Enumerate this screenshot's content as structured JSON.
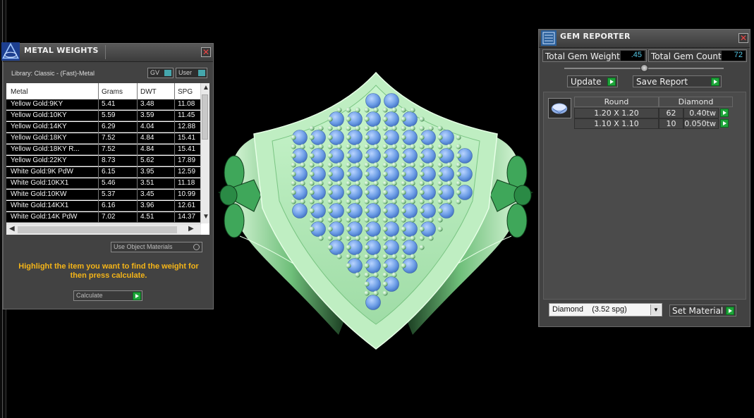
{
  "metal_weights": {
    "title": "METAL WEIGHTS",
    "library_label": "Library: Classic - (Fast)-Metal",
    "toggle_gv": "GV",
    "toggle_user": "User",
    "columns": [
      "Metal",
      "Grams",
      "DWT",
      "SPG"
    ],
    "rows": [
      [
        "Yellow Gold:9KY",
        "5.41",
        "3.48",
        "11.08"
      ],
      [
        "Yellow Gold:10KY",
        "5.59",
        "3.59",
        "11.45"
      ],
      [
        "Yellow Gold:14KY",
        "6.29",
        "4.04",
        "12.88"
      ],
      [
        "Yellow Gold:18KY",
        "7.52",
        "4.84",
        "15.41"
      ],
      [
        "Yellow Gold:18KY R...",
        "7.52",
        "4.84",
        "15.41"
      ],
      [
        "Yellow Gold:22KY",
        "8.73",
        "5.62",
        "17.89"
      ],
      [
        "White Gold:9K PdW",
        "6.15",
        "3.95",
        "12.59"
      ],
      [
        "White Gold:10KX1",
        "5.46",
        "3.51",
        "11.18"
      ],
      [
        "White Gold:10KW",
        "5.37",
        "3.45",
        "10.99"
      ],
      [
        "White Gold:14KX1",
        "6.16",
        "3.96",
        "12.61"
      ],
      [
        "White Gold:14K PdW",
        "7.02",
        "4.51",
        "14.37"
      ]
    ],
    "use_object_materials": "Use Object Materials",
    "hint": "Highlight the item you want to find the weight for then press calculate.",
    "calculate_label": "Calculate",
    "close": "✕"
  },
  "gem_reporter": {
    "title": "GEM REPORTER",
    "total_gem_weight_label": "Total Gem Weight",
    "total_gem_weight_value": ".45",
    "total_gem_count_label": "Total Gem Count",
    "total_gem_count_value": "72",
    "slider_level": 0.5,
    "update_label": "Update",
    "save_report_label": "Save Report",
    "table_header": [
      "Round",
      "Diamond"
    ],
    "rows": [
      {
        "size": "1.20 X 1.20",
        "count": "62",
        "weight": "0.40tw"
      },
      {
        "size": "1.10 X 1.10",
        "count": "10",
        "weight": "0.050tw"
      }
    ],
    "material_select": "Diamond    (3.52 spg)",
    "set_material_label": "Set Material",
    "close": "✕"
  },
  "colors": {
    "metal": "#a9e8b0",
    "metal_dark": "#2f7f3f",
    "gem": "#6d9ee6",
    "hint": "#f4b418",
    "accent": "#1ea53a"
  }
}
